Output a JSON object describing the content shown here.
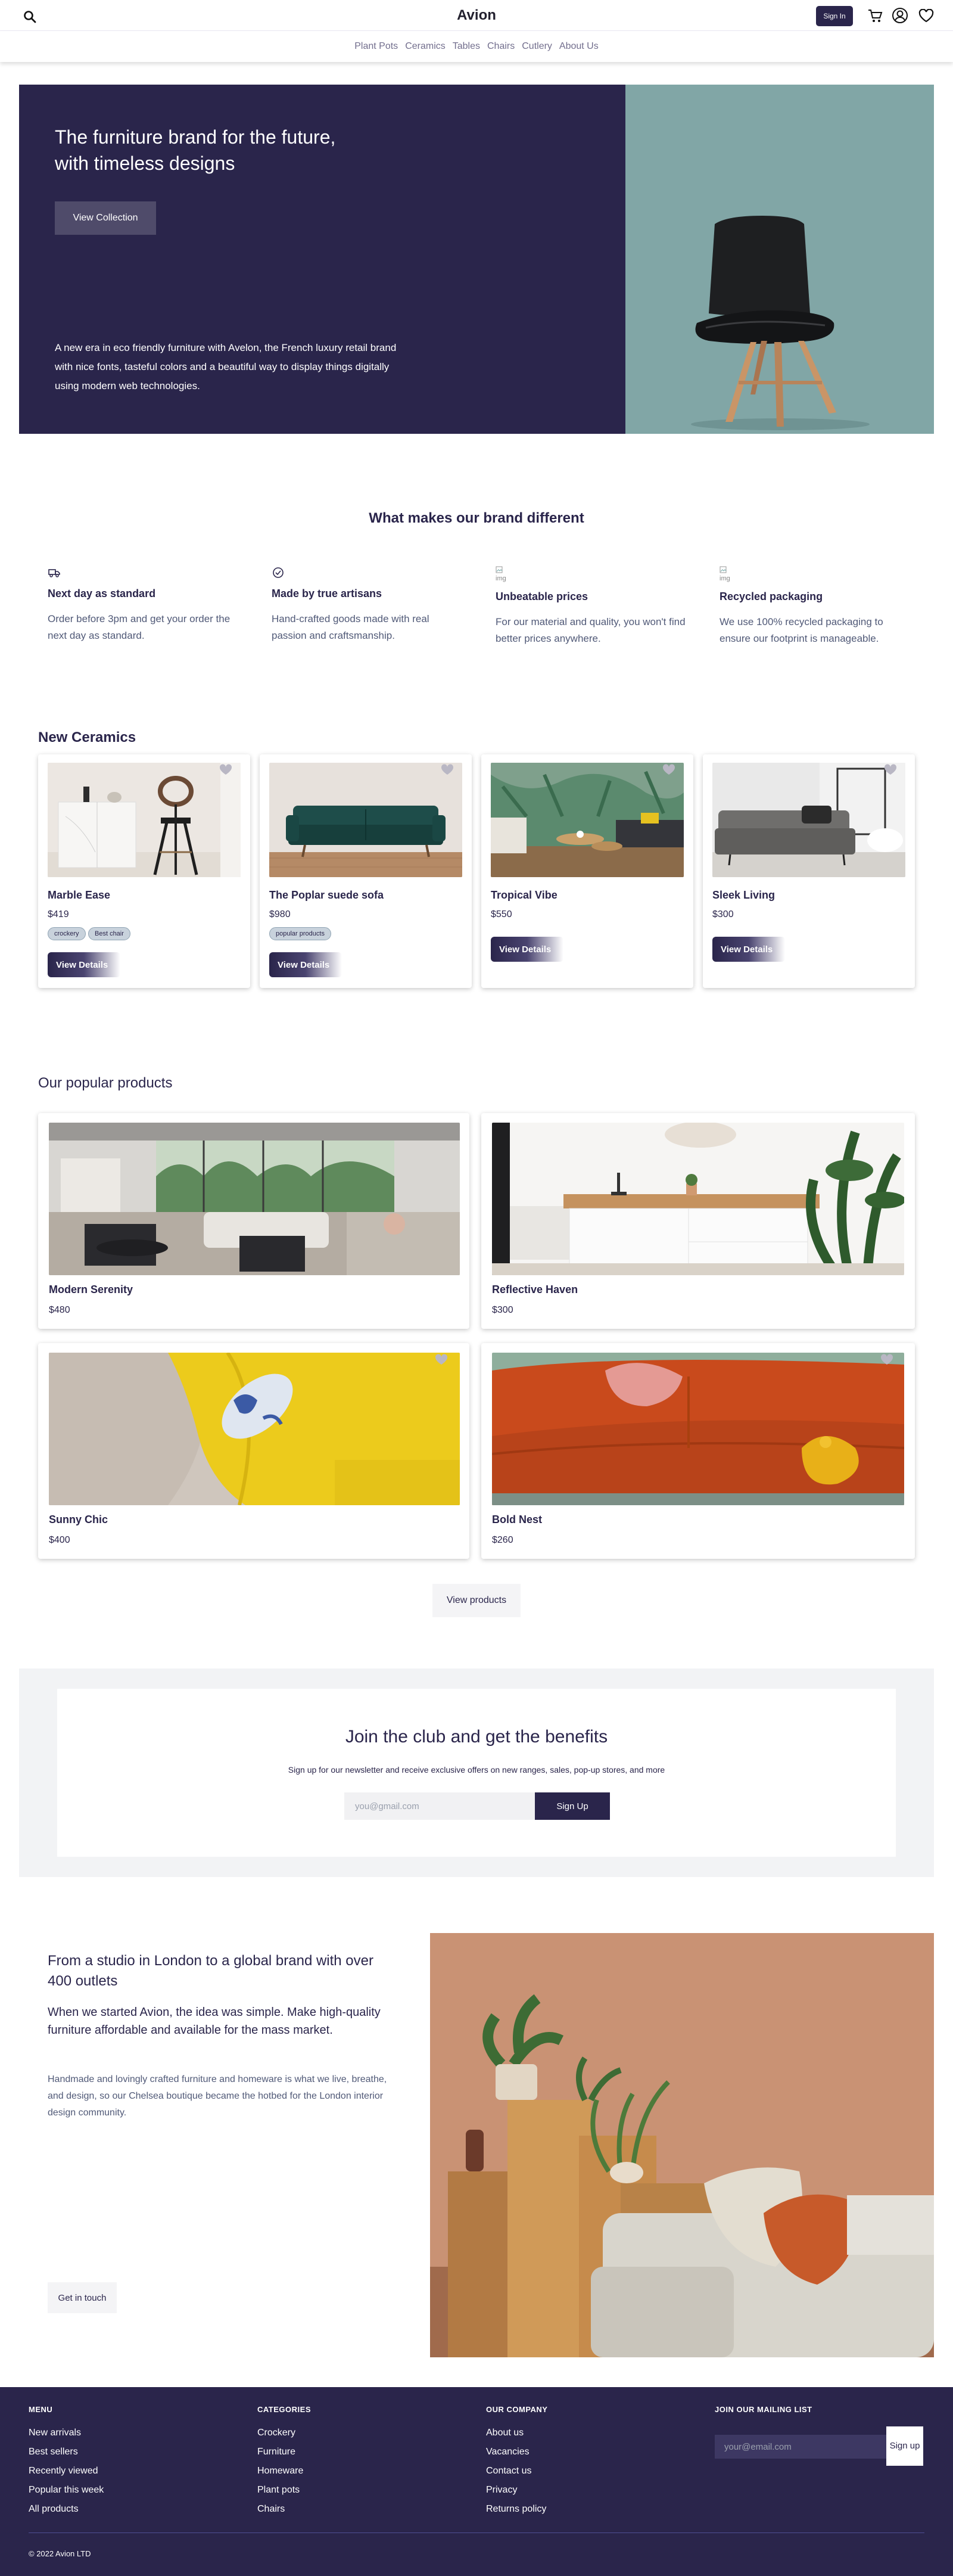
{
  "header": {
    "brand": "Avion",
    "sign_in": "Sign In",
    "nav": [
      "Plant Pots",
      "Ceramics",
      "Tables",
      "Chairs",
      "Cutlery",
      "About Us"
    ]
  },
  "hero": {
    "title": "The furniture brand for the future, with timeless designs",
    "button": "View Collection",
    "description": "A new era in eco friendly furniture with Avelon, the French luxury retail brand with nice fonts, tasteful colors and a beautiful way to display things digitally using modern web technologies."
  },
  "features": {
    "title": "What makes our brand different",
    "items": [
      {
        "icon": "delivery-truck-icon",
        "title": "Next day as standard",
        "desc": "Order before 3pm and get your order the next day as standard.",
        "img_alt": ""
      },
      {
        "icon": "checkmark-circle-icon",
        "title": "Made by true artisans",
        "desc": "Hand-crafted goods made with real passion and craftsmanship.",
        "img_alt": ""
      },
      {
        "icon": "broken-image-icon",
        "title": "Unbeatable prices",
        "desc": "For our material and quality, you won't find better prices anywhere.",
        "img_alt": "img"
      },
      {
        "icon": "broken-image-icon",
        "title": "Recycled packaging",
        "desc": "We use 100% recycled packaging to ensure our footprint is manageable.",
        "img_alt": "img"
      }
    ]
  },
  "ceramics": {
    "title": "New Ceramics",
    "details_label": "View Details",
    "products": [
      {
        "name": "Marble Ease",
        "price": "$419",
        "tags": [
          "crockery",
          "Best chair"
        ]
      },
      {
        "name": "The Poplar suede sofa",
        "price": "$980",
        "tags": [
          "popular products"
        ]
      },
      {
        "name": "Tropical Vibe",
        "price": "$550",
        "tags": []
      },
      {
        "name": "Sleek Living",
        "price": "$300",
        "tags": []
      }
    ]
  },
  "popular": {
    "title": "Our popular products",
    "products": [
      {
        "name": "Modern Serenity",
        "price": "$480"
      },
      {
        "name": "Reflective Haven",
        "price": "$300"
      },
      {
        "name": "Sunny Chic",
        "price": "$400"
      },
      {
        "name": "Bold Nest",
        "price": "$260"
      }
    ],
    "view_all": "View products"
  },
  "newsletter": {
    "title": "Join the club and get the benefits",
    "subtitle": "Sign up for our newsletter and receive exclusive offers on new ranges, sales, pop-up stores, and more",
    "placeholder": "you@gmail.com",
    "button": "Sign Up"
  },
  "about": {
    "title": "From a studio in London to a global brand with over 400 outlets",
    "subtitle": "When we started Avion, the idea was simple. Make high-quality furniture affordable and available for the mass market.",
    "body": "Handmade and lovingly crafted furniture and homeware is what we live, breathe, and design, so our Chelsea boutique became the hotbed for the London interior design community.",
    "button": "Get in touch"
  },
  "footer": {
    "menu": {
      "title": "MENU",
      "items": [
        "New arrivals",
        "Best sellers",
        "Recently viewed",
        "Popular this week",
        "All products"
      ]
    },
    "categories": {
      "title": "CATEGORIES",
      "items": [
        "Crockery",
        "Furniture",
        "Homeware",
        "Plant pots",
        "Chairs"
      ]
    },
    "company": {
      "title": "OUR COMPANY",
      "items": [
        "About us",
        "Vacancies",
        "Contact us",
        "Privacy",
        "Returns policy"
      ]
    },
    "mailing": {
      "title": "JOIN OUR MAILING LIST",
      "placeholder": "your@email.com",
      "button": "Sign up"
    },
    "copyright": "© 2022 Avion LTD"
  },
  "colors": {
    "primary": "#2a254b",
    "hero_right": "#81a6a6",
    "muted": "#505977",
    "footer": "#2a254b"
  }
}
